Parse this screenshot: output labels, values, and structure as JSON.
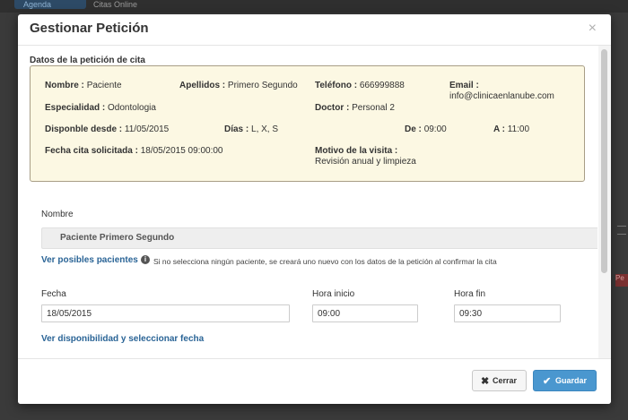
{
  "background": {
    "tab1": "Agenda",
    "tab2": "Citas Online",
    "right_badge": "Pe"
  },
  "modal": {
    "title": "Gestionar Petición",
    "close_symbol": "×"
  },
  "request_details": {
    "section_title": "Datos de la petición de cita",
    "nombre": {
      "label": "Nombre :",
      "value": "Paciente"
    },
    "apellidos": {
      "label": "Apellidos :",
      "value": "Primero Segundo"
    },
    "telefono": {
      "label": "Teléfono :",
      "value": "666999888"
    },
    "email": {
      "label": "Email :",
      "value": "info@clinicaenlanube.com"
    },
    "especialidad": {
      "label": "Especialidad :",
      "value": "Odontologia"
    },
    "doctor": {
      "label": "Doctor :",
      "value": "Personal 2"
    },
    "disponible_desde": {
      "label": "Disponble desde :",
      "value": "11/05/2015"
    },
    "dias": {
      "label": "Días :",
      "value": "L, X, S"
    },
    "de": {
      "label": "De :",
      "value": "09:00"
    },
    "a": {
      "label": "A :",
      "value": "11:00"
    },
    "fecha_solicitada": {
      "label": "Fecha cita solicitada :",
      "value": "18/05/2015 09:00:00"
    },
    "motivo": {
      "label": "Motivo de la visita :",
      "value": "Revisión anual y limpieza"
    }
  },
  "form": {
    "nombre_label": "Nombre",
    "nombre_value": "Paciente Primero Segundo",
    "ver_pacientes_link": "Ver posibles pacientes",
    "hint": "Si no selecciona ningún paciente, se creará uno nuevo con los datos de la petición al confirmar la cita",
    "fecha_label": "Fecha",
    "fecha_value": "18/05/2015",
    "hora_inicio_label": "Hora inicio",
    "hora_inicio_value": "09:00",
    "hora_fin_label": "Hora fin",
    "hora_fin_value": "09:30",
    "ver_disponibilidad_link": "Ver disponibilidad y seleccionar fecha"
  },
  "footer": {
    "cancel_label": "Cerrar",
    "save_label": "Guardar"
  },
  "colors": {
    "accent": "#4a97cf",
    "link": "#2a6496",
    "info_box_bg": "#fcf8e3"
  }
}
